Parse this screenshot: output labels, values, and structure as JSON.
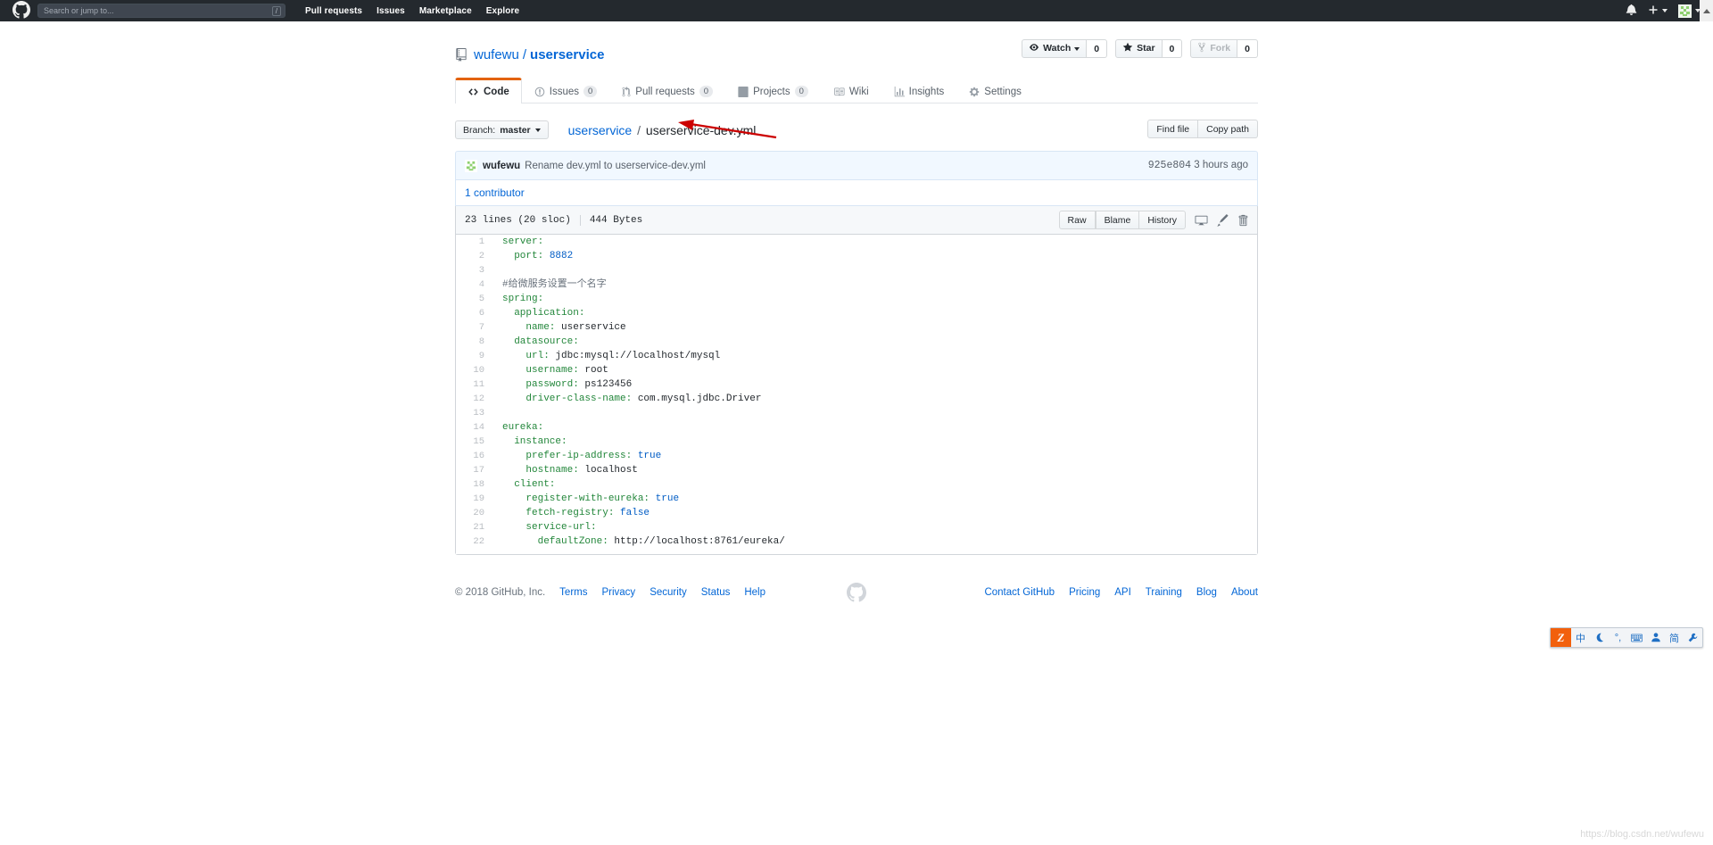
{
  "topbar": {
    "logo_icon": "github-mark-icon",
    "search": {
      "placeholder": "Search or jump to...",
      "value": "",
      "shortcut": "/"
    },
    "nav": [
      {
        "label": "Pull requests"
      },
      {
        "label": "Issues"
      },
      {
        "label": "Marketplace"
      },
      {
        "label": "Explore"
      }
    ],
    "notifications_icon": "bell-icon",
    "create_new_icon": "plus-icon",
    "avatar_icon": "user-avatar",
    "scroll_up_icon": "triangle-up-icon"
  },
  "repo": {
    "icon": "repo-book-icon",
    "owner": "wufewu",
    "separator": "/",
    "name": "userservice",
    "actions": [
      {
        "label": "Watch",
        "count": "0",
        "icon": "eye-icon",
        "has_caret": true,
        "disabled": false
      },
      {
        "label": "Star",
        "count": "0",
        "icon": "star-icon",
        "has_caret": false,
        "disabled": false
      },
      {
        "label": "Fork",
        "count": "0",
        "icon": "fork-icon",
        "has_caret": false,
        "disabled": true
      }
    ]
  },
  "tabs": [
    {
      "label": "Code",
      "icon": "code-icon",
      "count": null,
      "active": true
    },
    {
      "label": "Issues",
      "icon": "issue-opened-icon",
      "count": "0",
      "active": false
    },
    {
      "label": "Pull requests",
      "icon": "git-pull-request-icon",
      "count": "0",
      "active": false
    },
    {
      "label": "Projects",
      "icon": "project-board-icon",
      "count": "0",
      "active": false
    },
    {
      "label": "Wiki",
      "icon": "book-icon",
      "count": null,
      "active": false
    },
    {
      "label": "Insights",
      "icon": "graph-icon",
      "count": null,
      "active": false
    },
    {
      "label": "Settings",
      "icon": "gear-icon",
      "count": null,
      "active": false
    }
  ],
  "filenav": {
    "branch_prefix": "Branch:",
    "branch_name": "master",
    "breadcrumb_root": "userservice",
    "breadcrumb_sep": "/",
    "breadcrumb_file": "userservice-dev.yml",
    "find_file_label": "Find file",
    "copy_path_label": "Copy path",
    "annotation_icon": "red-arrow-annotation"
  },
  "commit": {
    "avatar_icon": "identicon-avatar",
    "author": "wufewu",
    "message": "Rename dev.yml to userservice-dev.yml",
    "sha": "925e804",
    "time": "3 hours ago",
    "contributors_label": "1 contributor"
  },
  "blob": {
    "lines_label": "23 lines (20 sloc)",
    "size_label": "444 Bytes",
    "buttons": [
      {
        "label": "Raw"
      },
      {
        "label": "Blame"
      },
      {
        "label": "History"
      }
    ],
    "icons": [
      {
        "name": "desktop-icon"
      },
      {
        "name": "pencil-edit-icon"
      },
      {
        "name": "trash-delete-icon"
      }
    ],
    "code": [
      {
        "n": "1",
        "tokens": [
          {
            "t": "server:",
            "c": "k"
          }
        ]
      },
      {
        "n": "2",
        "tokens": [
          {
            "t": "  port: ",
            "c": "k"
          },
          {
            "t": "8882",
            "c": "b"
          }
        ]
      },
      {
        "n": "3",
        "tokens": []
      },
      {
        "n": "4",
        "tokens": [
          {
            "t": "#给微服务设置一个名字",
            "c": "c"
          }
        ]
      },
      {
        "n": "5",
        "tokens": [
          {
            "t": "spring:",
            "c": "k"
          }
        ]
      },
      {
        "n": "6",
        "tokens": [
          {
            "t": "  application:",
            "c": "k"
          }
        ]
      },
      {
        "n": "7",
        "tokens": [
          {
            "t": "    name: ",
            "c": "k"
          },
          {
            "t": "userservice",
            "c": ""
          }
        ]
      },
      {
        "n": "8",
        "tokens": [
          {
            "t": "  datasource:",
            "c": "k"
          }
        ]
      },
      {
        "n": "9",
        "tokens": [
          {
            "t": "    url: ",
            "c": "k"
          },
          {
            "t": "jdbc:mysql://localhost/mysql",
            "c": ""
          }
        ]
      },
      {
        "n": "10",
        "tokens": [
          {
            "t": "    username: ",
            "c": "k"
          },
          {
            "t": "root",
            "c": ""
          }
        ]
      },
      {
        "n": "11",
        "tokens": [
          {
            "t": "    password: ",
            "c": "k"
          },
          {
            "t": "ps123456",
            "c": ""
          }
        ]
      },
      {
        "n": "12",
        "tokens": [
          {
            "t": "    driver-class-name: ",
            "c": "k"
          },
          {
            "t": "com.mysql.jdbc.Driver",
            "c": ""
          }
        ]
      },
      {
        "n": "13",
        "tokens": []
      },
      {
        "n": "14",
        "tokens": [
          {
            "t": "eureka:",
            "c": "k"
          }
        ]
      },
      {
        "n": "15",
        "tokens": [
          {
            "t": "  instance:",
            "c": "k"
          }
        ]
      },
      {
        "n": "16",
        "tokens": [
          {
            "t": "    prefer-ip-address: ",
            "c": "k"
          },
          {
            "t": "true",
            "c": "b"
          }
        ]
      },
      {
        "n": "17",
        "tokens": [
          {
            "t": "    hostname: ",
            "c": "k"
          },
          {
            "t": "localhost",
            "c": ""
          }
        ]
      },
      {
        "n": "18",
        "tokens": [
          {
            "t": "  client:",
            "c": "k"
          }
        ]
      },
      {
        "n": "19",
        "tokens": [
          {
            "t": "    register-with-eureka: ",
            "c": "k"
          },
          {
            "t": "true",
            "c": "b"
          }
        ]
      },
      {
        "n": "20",
        "tokens": [
          {
            "t": "    fetch-registry: ",
            "c": "k"
          },
          {
            "t": "false",
            "c": "b"
          }
        ]
      },
      {
        "n": "21",
        "tokens": [
          {
            "t": "    service-url:",
            "c": "k"
          }
        ]
      },
      {
        "n": "22",
        "tokens": [
          {
            "t": "      defaultZone: ",
            "c": "k"
          },
          {
            "t": "http://localhost:8761/eureka/",
            "c": ""
          }
        ]
      }
    ]
  },
  "footer": {
    "copyright": "© 2018 GitHub, Inc.",
    "left_links": [
      {
        "label": "Terms"
      },
      {
        "label": "Privacy"
      },
      {
        "label": "Security"
      },
      {
        "label": "Status"
      },
      {
        "label": "Help"
      }
    ],
    "mark_icon": "github-mark-icon",
    "right_links": [
      {
        "label": "Contact GitHub"
      },
      {
        "label": "Pricing"
      },
      {
        "label": "API"
      },
      {
        "label": "Training"
      },
      {
        "label": "Blog"
      },
      {
        "label": "About"
      }
    ]
  },
  "ime_toolbar": {
    "logo": "Z",
    "items": [
      {
        "label": "中",
        "name": "chinese-mode-icon"
      },
      {
        "label": "",
        "name": "moon-icon"
      },
      {
        "label": "°,",
        "name": "punctuation-icon"
      },
      {
        "label": "",
        "name": "keyboard-icon"
      },
      {
        "label": "",
        "name": "user-icon"
      },
      {
        "label": "简",
        "name": "simplified-chinese-icon"
      },
      {
        "label": "",
        "name": "wrench-icon"
      }
    ]
  },
  "watermark": {
    "text": "https://blog.csdn.net/wufewu"
  },
  "colors": {
    "header_bg": "#24292e",
    "accent_link": "#0366d6",
    "active_tab_border": "#e36209",
    "commit_bg": "#f1f8ff",
    "annotation_red": "#cc0000",
    "ime_orange": "#f2600c"
  }
}
